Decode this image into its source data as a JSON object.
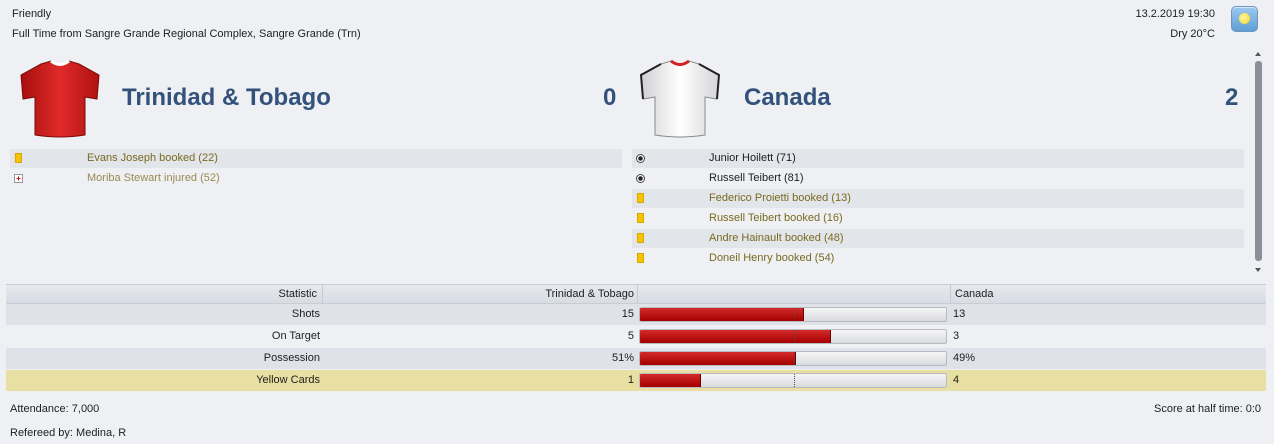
{
  "header": {
    "competition": "Friendly",
    "result_line": "Full Time from Sangre Grande Regional Complex, Sangre Grande (Trn)",
    "datetime": "13.2.2019 19:30",
    "weather": "Dry 20°C",
    "weather_icon": "sun-icon"
  },
  "home": {
    "name": "Trinidad & Tobago",
    "score": "0",
    "kit_color": "#d21f1f",
    "events": [
      {
        "type": "booking",
        "icon": "yellow-card-icon",
        "text": "Evans Joseph booked (22)"
      },
      {
        "type": "injury",
        "icon": "injury-icon",
        "text": "Moriba Stewart injured (52)"
      }
    ]
  },
  "away": {
    "name": "Canada",
    "score": "2",
    "kit_color": "#f4f4f4",
    "events": [
      {
        "type": "goal",
        "icon": "ball-icon",
        "text": "Junior Hoilett (71)"
      },
      {
        "type": "goal",
        "icon": "ball-icon",
        "text": "Russell Teibert (81)"
      },
      {
        "type": "booking",
        "icon": "yellow-card-icon",
        "text": "Federico Proietti booked (13)"
      },
      {
        "type": "booking",
        "icon": "yellow-card-icon",
        "text": "Russell Teibert booked (16)"
      },
      {
        "type": "booking",
        "icon": "yellow-card-icon",
        "text": "Andre Hainault booked (48)"
      },
      {
        "type": "booking",
        "icon": "yellow-card-icon",
        "text": "Doneil Henry booked (54)"
      }
    ]
  },
  "stats": {
    "headers": {
      "statistic": "Statistic",
      "home": "Trinidad & Tobago",
      "away": "Canada"
    },
    "rows": [
      {
        "label": "Shots",
        "home": "15",
        "away": "13",
        "home_share": 0.536
      },
      {
        "label": "On Target",
        "home": "5",
        "away": "3",
        "home_share": 0.625
      },
      {
        "label": "Possession",
        "home": "51%",
        "away": "49%",
        "home_share": 0.51
      },
      {
        "label": "Yellow Cards",
        "home": "1",
        "away": "4",
        "home_share": 0.2
      }
    ]
  },
  "footer": {
    "attendance": "Attendance: 7,000",
    "referee": "Refereed by: Medina, R",
    "half_time": "Score at half time: 0:0"
  },
  "colors": {
    "team_name": "#33517b",
    "bar_fill": "#b80f0f",
    "highlight_row": "#e8e0a2"
  }
}
